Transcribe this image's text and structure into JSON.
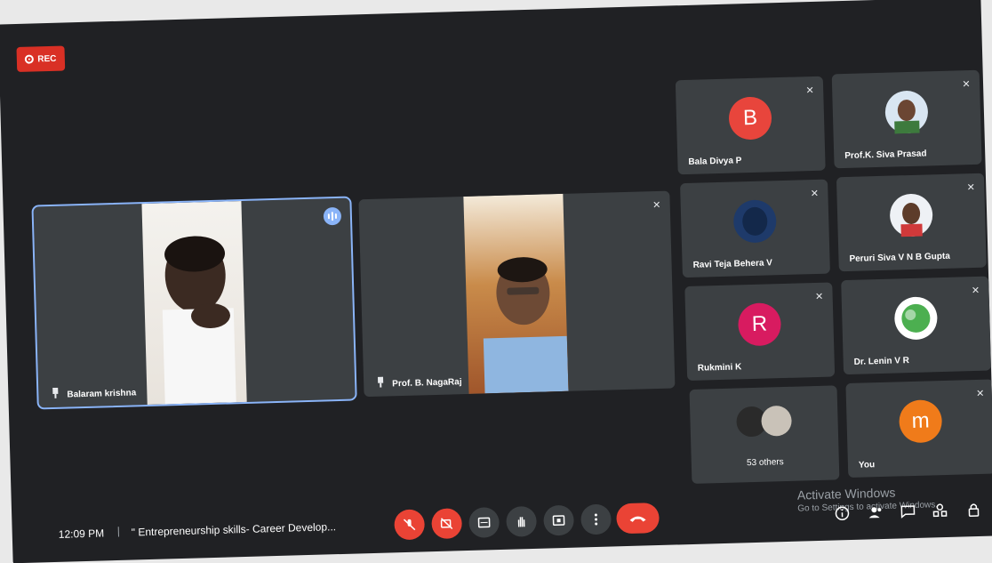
{
  "recording": {
    "label": "REC"
  },
  "main_tiles": [
    {
      "name": "Balaram krishna"
    },
    {
      "name": "Prof. B. NagaRaj"
    }
  ],
  "grid_tiles": [
    {
      "name": "Bala Divya P",
      "initial": "B",
      "color": "#e8453c"
    },
    {
      "name": "Prof.K. Siva Prasad"
    },
    {
      "name": "Ravi Teja Behera V"
    },
    {
      "name": "Peruri Siva V N B Gupta"
    },
    {
      "name": "Rukmini K",
      "initial": "R",
      "color": "#d81b60"
    },
    {
      "name": "Dr. Lenin V R"
    },
    {
      "name": "53 others"
    },
    {
      "name": "You",
      "initial": "m",
      "color": "#f07b1a"
    }
  ],
  "bottom_bar": {
    "time": "12:09 PM",
    "separator": "|",
    "meeting_title": "\" Entrepreneurship skills- Career Develop..."
  },
  "watermark": {
    "line1": "Activate Windows",
    "line2": "Go to Settings to activate Windows."
  }
}
